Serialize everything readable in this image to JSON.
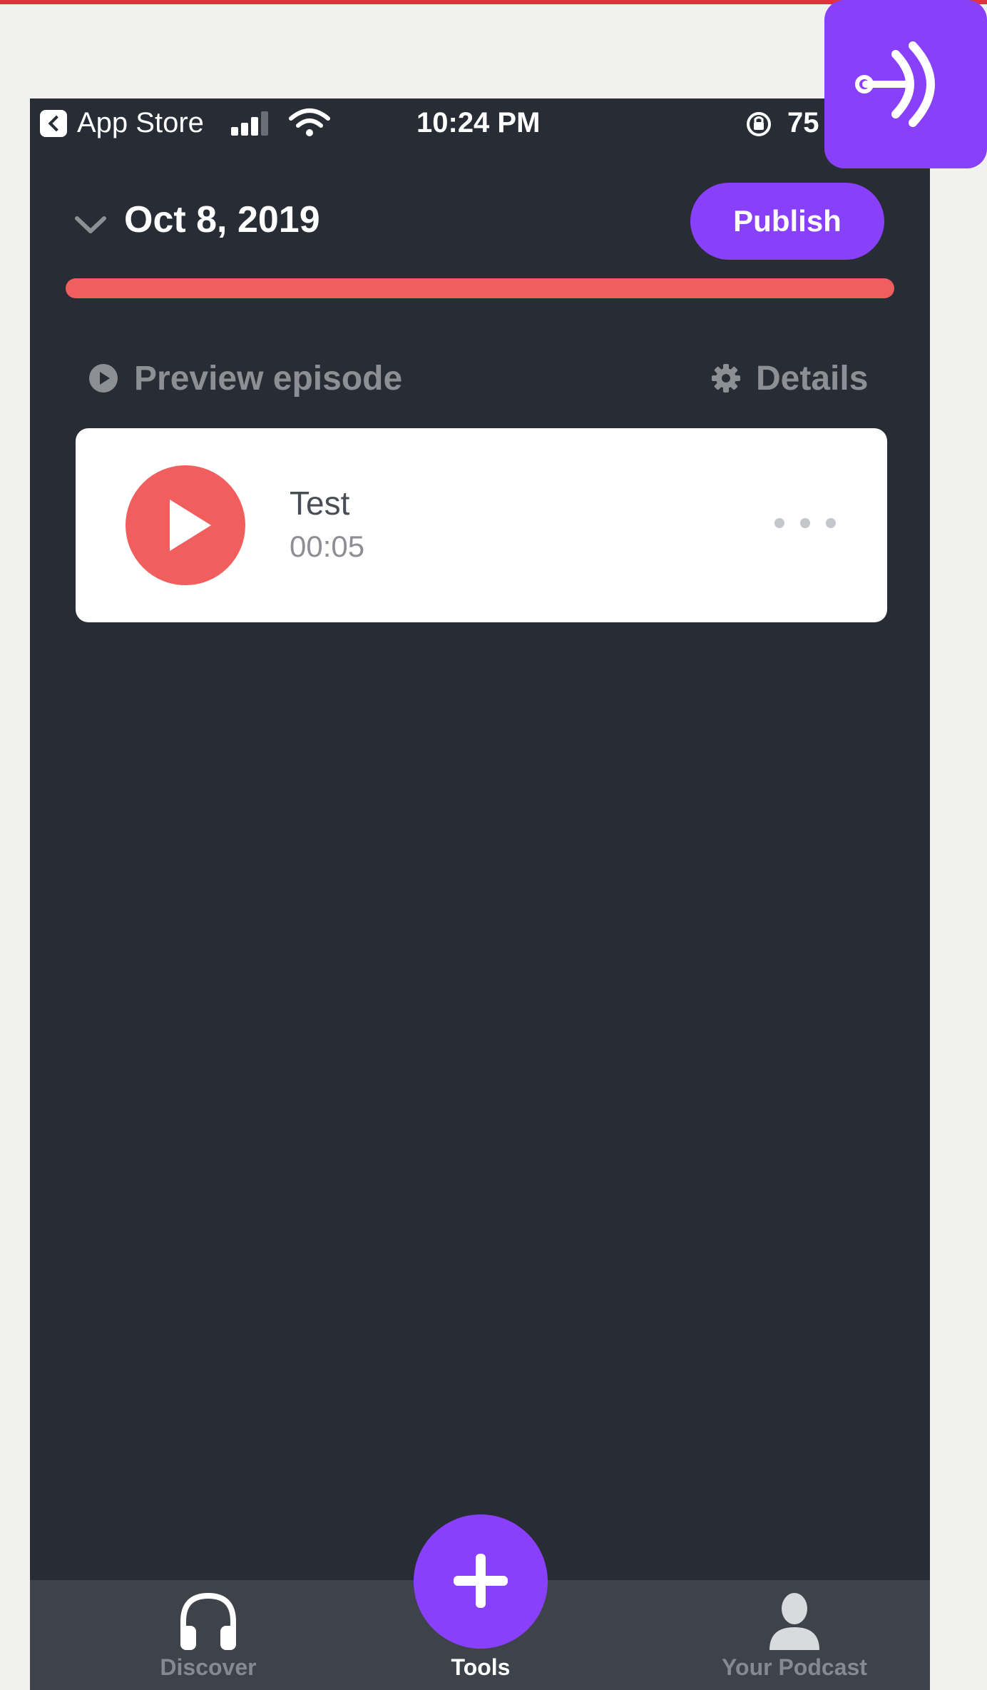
{
  "status_bar": {
    "back_app": "App Store",
    "time": "10:24 PM",
    "battery": "75"
  },
  "header": {
    "date": "Oct 8, 2019",
    "publish_label": "Publish",
    "progress_color": "#f05e5e"
  },
  "actions": {
    "preview_label": "Preview episode",
    "details_label": "Details"
  },
  "segments": [
    {
      "title": "Test",
      "duration": "00:05"
    }
  ],
  "bottom_nav": {
    "items": [
      {
        "label": "Discover",
        "icon": "headphones-icon",
        "active": false
      },
      {
        "label": "Tools",
        "icon": "plus-icon",
        "active": true
      },
      {
        "label": "Your Podcast",
        "icon": "person-icon",
        "active": false
      }
    ]
  },
  "colors": {
    "accent": "#8940fa",
    "coral": "#f05e5e",
    "background": "#282c35"
  },
  "logo": {
    "icon": "anchor-podcast-logo-icon"
  }
}
